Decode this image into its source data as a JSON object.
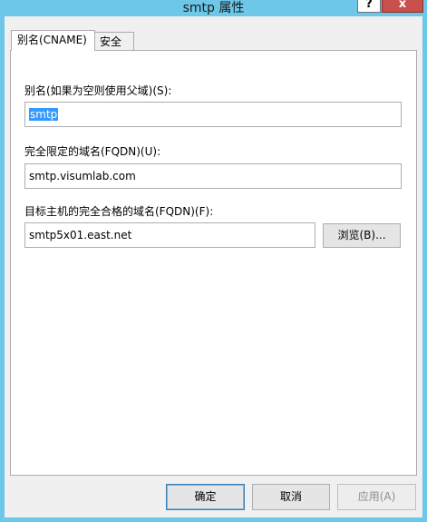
{
  "window": {
    "title": "smtp 属性",
    "help_glyph": "?",
    "close_glyph": "x"
  },
  "tabs": [
    {
      "label": "别名(CNAME)",
      "active": true
    },
    {
      "label": "安全",
      "active": false
    }
  ],
  "fields": {
    "alias": {
      "label": "别名(如果为空则使用父域)(S):",
      "value": "smtp",
      "selected": true
    },
    "fqdn": {
      "label": "完全限定的域名(FQDN)(U):",
      "value": "smtp.visumlab.com"
    },
    "target": {
      "label": "目标主机的完全合格的域名(FQDN)(F):",
      "value": "smtp5x01.east.net",
      "browse_label": "浏览(B)..."
    }
  },
  "buttons": {
    "ok": "确定",
    "cancel": "取消",
    "apply": "应用(A)"
  }
}
